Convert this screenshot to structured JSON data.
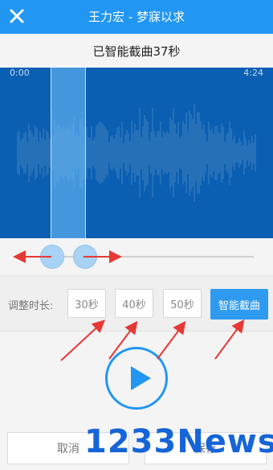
{
  "header": {
    "close_icon": "close-icon",
    "title": "王力宏 - 梦寐以求"
  },
  "clip_status": "已智能截曲37秒",
  "waveform": {
    "start_time": "0:00",
    "end_time": "4:24"
  },
  "duration": {
    "label": "调整时长:",
    "options": [
      "30秒",
      "40秒",
      "50秒"
    ],
    "smart_button": "智能截曲"
  },
  "player": {
    "play_icon": "play-icon"
  },
  "actions": {
    "cancel": "取消",
    "save": "保存"
  },
  "watermark": "1233News",
  "colors": {
    "accent": "#2196f3",
    "waveform_bg": "#0a5fb3",
    "annotation_arrow": "#e53935"
  }
}
